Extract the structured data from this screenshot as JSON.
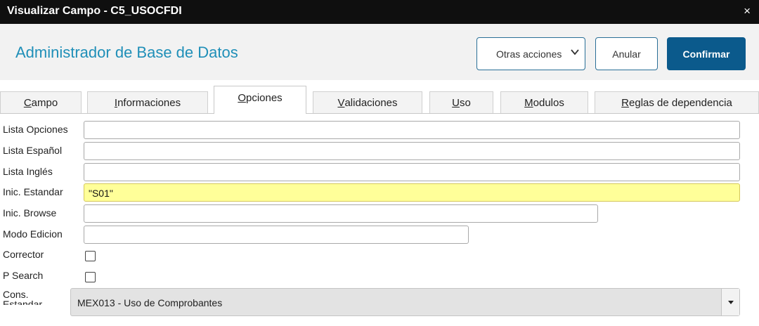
{
  "window": {
    "title": "Visualizar Campo - C5_USOCFDI",
    "close_glyph": "×"
  },
  "header": {
    "app_title": "Administrador de Base de Datos",
    "buttons": {
      "otras": "Otras acciones",
      "anular": "Anular",
      "confirmar": "Confirmar"
    }
  },
  "tabs": [
    {
      "first": "C",
      "rest": "ampo"
    },
    {
      "first": "I",
      "rest": "nformaciones"
    },
    {
      "first": "O",
      "rest": "pciones",
      "active": true
    },
    {
      "first": "V",
      "rest": "alidaciones"
    },
    {
      "first": "U",
      "rest": "so"
    },
    {
      "first": "M",
      "rest": "odulos"
    },
    {
      "first": "R",
      "rest": "eglas de dependencia"
    }
  ],
  "form": {
    "lista_opciones": {
      "label": "Lista Opciones",
      "value": ""
    },
    "lista_espanol": {
      "label": "Lista Español",
      "value": ""
    },
    "lista_ingles": {
      "label": "Lista Inglés",
      "value": ""
    },
    "inic_estandar": {
      "label": "Inic. Estandar",
      "value": "\"S01\""
    },
    "inic_browse": {
      "label": "Inic. Browse",
      "value": ""
    },
    "modo_edicion": {
      "label": "Modo Edicion",
      "value": ""
    },
    "corrector": {
      "label": "Corrector",
      "checked": false
    },
    "p_search": {
      "label": "P Search",
      "checked": false
    },
    "cons_estandar": {
      "label": "Cons. Estandar",
      "value": "MEX013 - Uso de Comprobantes"
    }
  },
  "colors": {
    "accent": "#1f8fb8",
    "primary_button": "#0b5a8c",
    "highlight_field": "#ffff99"
  }
}
